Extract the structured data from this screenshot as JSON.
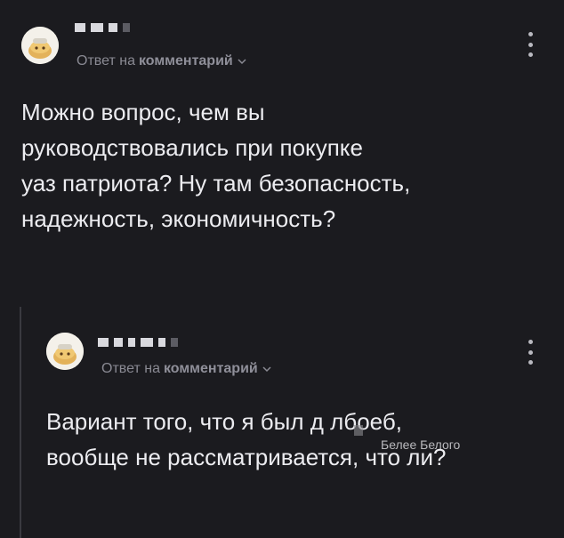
{
  "comments": [
    {
      "reply_prefix": "Ответ на",
      "reply_target": "комментарий",
      "text": "Можно вопрос, чем вы\nруководствовались при покупке\nуаз патриота? Ну там безопасность,\nнадежность, экономичность?"
    },
    {
      "reply_prefix": "Ответ на",
      "reply_target": "комментарий",
      "text": "Вариант того, что я был д   лбоеб,\nвообще не рассматривается, что ли?"
    }
  ],
  "watermark": "Белее Белого",
  "icons": {
    "avatar": "cat-avatar-icon",
    "chevron": "chevron-down-icon",
    "menu": "more-vertical-icon"
  }
}
